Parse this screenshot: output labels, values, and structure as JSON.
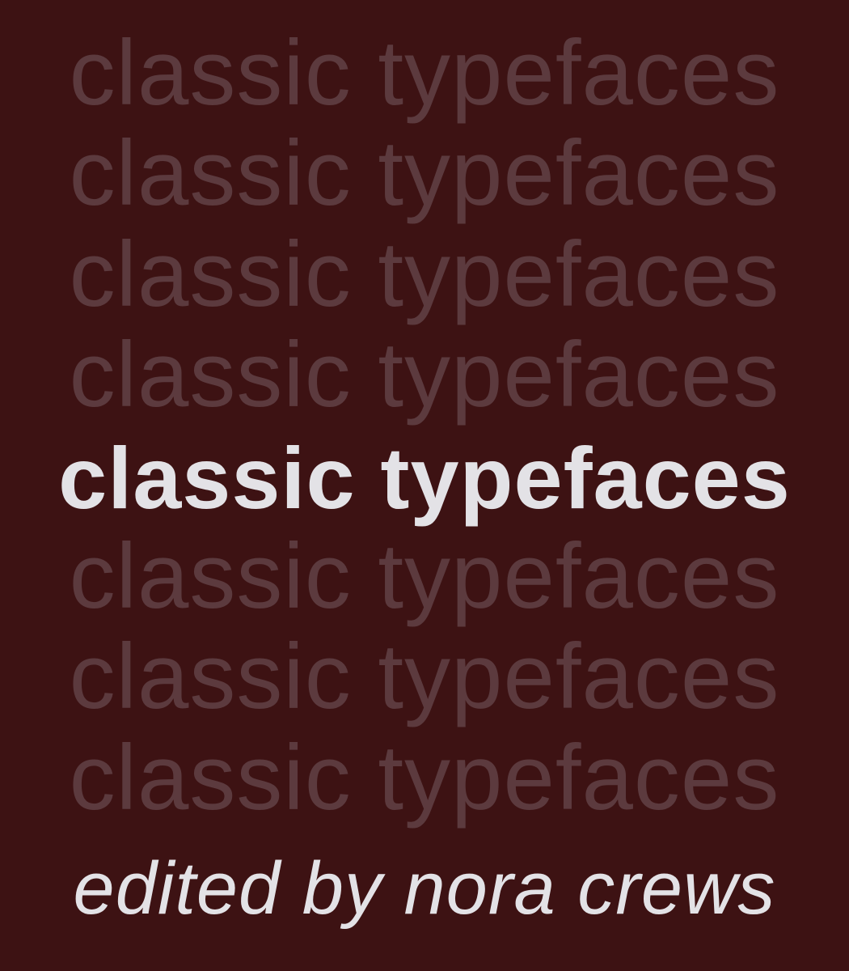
{
  "cover": {
    "background_color": "#3d1213",
    "ghost_text_color": "#5c3a3e",
    "highlight_text_color": "#e3e2e6",
    "title_lines": [
      "classic typefaces",
      "classic typefaces",
      "classic typefaces",
      "classic typefaces",
      "classic typefaces",
      "classic typefaces",
      "classic typefaces",
      "classic typefaces"
    ],
    "credit": "edited by nora crews"
  }
}
